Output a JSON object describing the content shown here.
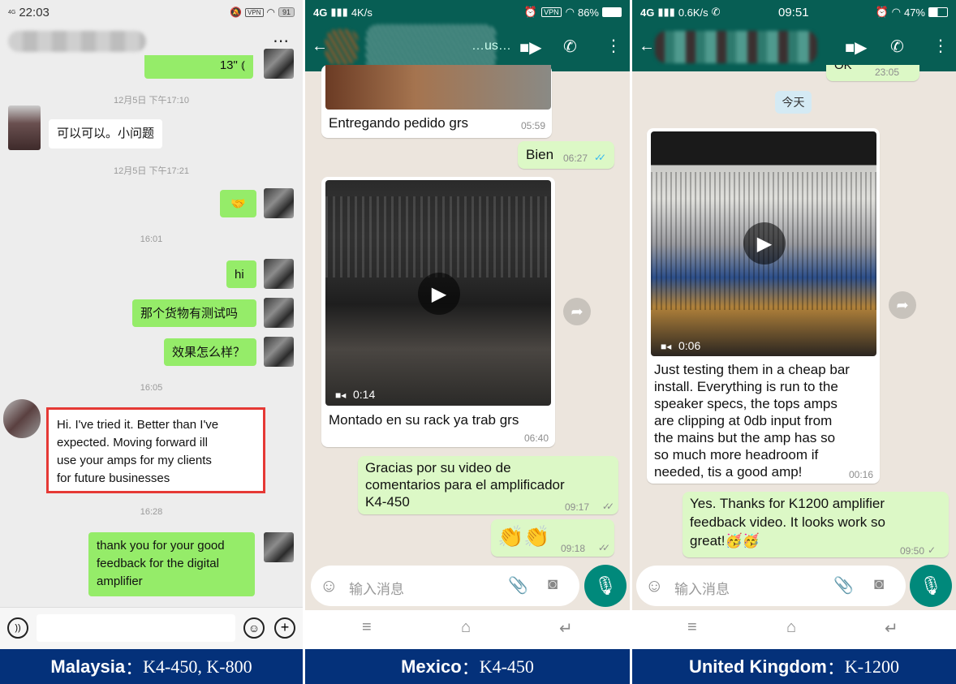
{
  "colors": {
    "wechat_green": "#95ec69",
    "whatsapp_teal": "#075e54",
    "whatsapp_out": "#dcf8c6",
    "banner": "#04317a",
    "highlight_border": "#e53935",
    "mic_button": "#00897b"
  },
  "malaysia": {
    "status": {
      "network": "4G",
      "time": "22:03",
      "vpn": "VPN",
      "battery": "91"
    },
    "menu_icon": "⋯",
    "messages": [
      {
        "type": "voice",
        "side": "out",
        "text": "13\""
      },
      {
        "type": "timestamp",
        "text": "12月5日 下午17:10"
      },
      {
        "type": "text",
        "side": "in",
        "text": "可以可以。小问题"
      },
      {
        "type": "timestamp",
        "text": "12月5日 下午17:21"
      },
      {
        "type": "emoji",
        "side": "out",
        "text": "🤝"
      },
      {
        "type": "timestamp",
        "text": "16:01"
      },
      {
        "type": "text",
        "side": "out",
        "text": "hi"
      },
      {
        "type": "text",
        "side": "out",
        "text": "那个货物有测试吗"
      },
      {
        "type": "text",
        "side": "out",
        "text": "效果怎么样？"
      },
      {
        "type": "timestamp",
        "text": "16:05"
      },
      {
        "type": "text",
        "side": "in",
        "highlighted": true,
        "lines": [
          "Hi. I've tried it. Better than I've",
          "expected. Moving forward ill",
          "use your amps for my clients",
          "for future businesses"
        ]
      },
      {
        "type": "timestamp",
        "text": "16:28"
      },
      {
        "type": "text",
        "side": "out",
        "lines": [
          "thank you for your good",
          "feedback for the digital",
          "amplifier"
        ]
      }
    ]
  },
  "mexico": {
    "status": {
      "network": "4G",
      "speed": "4K/s",
      "vpn": "VPN",
      "battery": "86%"
    },
    "header_name": "…us…",
    "messages": [
      {
        "type": "image",
        "side": "in",
        "caption": "Entregando pedido grs",
        "time": "05:59"
      },
      {
        "type": "text",
        "side": "out",
        "text": "Bien",
        "time": "06:27",
        "ticks": "✓✓",
        "read": true
      },
      {
        "type": "video",
        "side": "in",
        "duration": "0:14",
        "caption": "Montado en su rack ya trab grs",
        "time": "06:40"
      },
      {
        "type": "text",
        "side": "out",
        "lines": [
          "Gracias por su video de",
          "comentarios para el amplificador",
          "K4-450"
        ],
        "time": "09:17",
        "ticks": "✓✓"
      },
      {
        "type": "emoji",
        "side": "out",
        "text": "👏👏",
        "time": "09:18",
        "ticks": "✓✓"
      }
    ],
    "input_placeholder": "输入消息"
  },
  "uk": {
    "status": {
      "network": "4G",
      "speed": "0.6K/s",
      "time": "09:51",
      "battery": "47%"
    },
    "messages": [
      {
        "type": "text",
        "side": "out",
        "text": "OK",
        "time": "23:05"
      },
      {
        "type": "date",
        "text": "今天"
      },
      {
        "type": "video",
        "side": "in",
        "duration": "0:06",
        "lines": [
          "Just testing them in a cheap bar",
          "install. Everything is run to the",
          "speaker specs, the tops amps",
          "are clipping at 0db input from",
          "the mains but the amp has so",
          "so much more headroom if",
          "needed, tis a good amp!"
        ],
        "time": "00:16"
      },
      {
        "type": "text",
        "side": "out",
        "lines": [
          "Yes. Thanks for K1200 amplifier",
          "feedback video. It looks work so",
          "great!🥳🥳"
        ],
        "time": "09:50",
        "ticks": "✓"
      }
    ],
    "input_placeholder": "输入消息"
  },
  "banner": [
    {
      "country": "Malaysia",
      "sep": "：",
      "models": "K4-450, K-800"
    },
    {
      "country": "Mexico",
      "sep": "：",
      "models": "K4-450"
    },
    {
      "country": "United Kingdom",
      "sep": "：",
      "models": "K-1200"
    }
  ]
}
